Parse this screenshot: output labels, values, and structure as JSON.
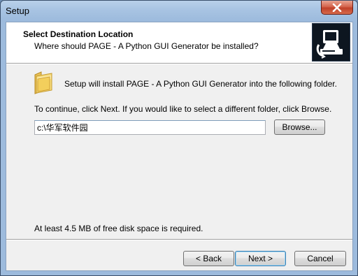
{
  "window": {
    "title": "Setup"
  },
  "header": {
    "title": "Select Destination Location",
    "subtitle": "Where should PAGE - A Python GUI Generator be installed?"
  },
  "body": {
    "intro": "Setup will install PAGE - A Python GUI Generator into the following folder.",
    "instructions": "To continue, click Next. If you would like to select a different folder, click Browse.",
    "path_value": "c:\\华军软件园",
    "browse_label": "Browse...",
    "disk_space": "At least 4.5 MB of free disk space is required."
  },
  "footer": {
    "back_label": "< Back",
    "next_label": "Next >",
    "cancel_label": "Cancel"
  },
  "icons": {
    "close": "close-icon",
    "wizard_logo": "setup-computer-icon",
    "folder": "folder-icon"
  }
}
